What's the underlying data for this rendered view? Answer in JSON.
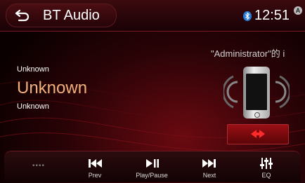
{
  "header": {
    "title": "BT Audio",
    "time": "12:51"
  },
  "icons": {
    "back": "back-arrow-icon",
    "bluetooth": "bluetooth-icon",
    "a_badge": "a-badge-icon"
  },
  "device": {
    "name": "\"Administrator\"的 i"
  },
  "track": {
    "artist": "Unknown",
    "title": "Unknown",
    "album": "Unknown"
  },
  "controls": {
    "more": "••••",
    "prev": "Prev",
    "playpause": "Play/Pause",
    "next": "Next",
    "eq": "EQ"
  },
  "colors": {
    "accent": "#c8101a",
    "track_title": "#f0b07a"
  }
}
